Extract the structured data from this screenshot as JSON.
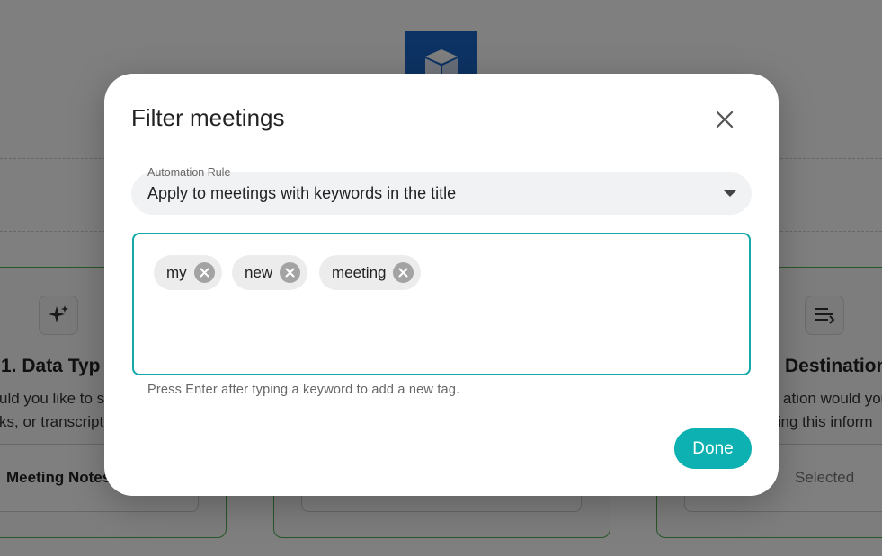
{
  "background": {
    "left_card": {
      "title": "1. Data Typ",
      "desc_lines": [
        "uld you like to s",
        "ks, or transcript"
      ],
      "option": "Meeting Notes"
    },
    "right_card": {
      "title": "Destination",
      "desc_lines": [
        "ation would you",
        "ling this inform"
      ],
      "selected": "Selected"
    },
    "icons": {
      "logo": "cube-logo-icon",
      "left_card": "sparkle-icon",
      "right_card": "sort-filter-icon"
    }
  },
  "modal": {
    "title": "Filter meetings",
    "close_icon": "close-icon",
    "automation_rule": {
      "label": "Automation Rule",
      "value": "Apply to meetings with keywords in the title"
    },
    "tags": [
      {
        "label": "my"
      },
      {
        "label": "new"
      },
      {
        "label": "meeting"
      }
    ],
    "helper_text": "Press Enter after typing a keyword to add a new tag.",
    "done_label": "Done"
  },
  "colors": {
    "accent": "#0db1b1",
    "overlay": "rgba(0,0,0,0.5)",
    "card_border": "#4caf50",
    "logo": "#1a66c9"
  }
}
